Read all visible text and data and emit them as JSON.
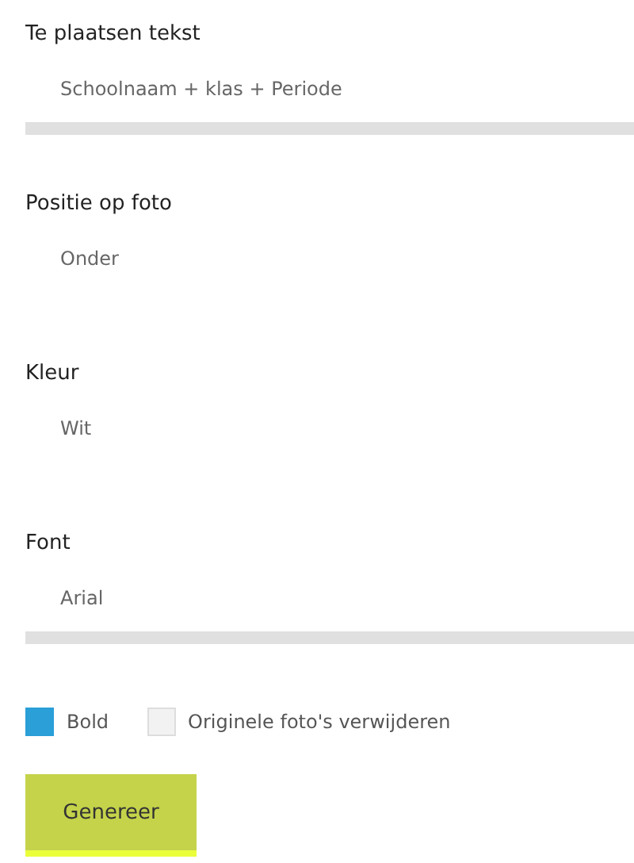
{
  "fields": [
    {
      "label": "Te plaatsen tekst",
      "value": "Schoolnaam + klas + Periode",
      "underline": true
    },
    {
      "label": "Positie op foto",
      "value": "Onder",
      "underline": false
    },
    {
      "label": "Kleur",
      "value": "Wit",
      "underline": false
    },
    {
      "label": "Font",
      "value": "Arial",
      "underline": true
    }
  ],
  "options": [
    {
      "label": "Bold",
      "checked": true
    },
    {
      "label": "Originele foto's verwijderen",
      "checked": false
    }
  ],
  "button": "Genereer"
}
